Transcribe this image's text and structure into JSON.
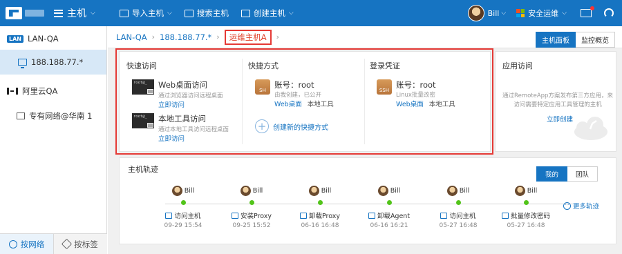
{
  "topbar": {
    "menu_label": "主机",
    "actions": [
      {
        "label": "导入主机",
        "has_caret": true
      },
      {
        "label": "搜索主机",
        "has_caret": false
      },
      {
        "label": "创建主机",
        "has_caret": true
      }
    ],
    "user_name": "Bill",
    "ops_label": "安全运维",
    "brand_color": "#1674c2"
  },
  "sidebar": {
    "lan_badge": "LAN",
    "lan_label": "LAN-QA",
    "host_label": "188.188.77.*",
    "aliyun_label": "阿里云QA",
    "vpc_label": "专有网络@华南 1",
    "tabs": [
      {
        "label": "按网络",
        "icon": "globe-icon",
        "active": true
      },
      {
        "label": "按标签",
        "icon": "tag-icon",
        "active": false
      }
    ]
  },
  "breadcrumb": {
    "items": [
      "LAN-QA",
      "188.188.77.*"
    ],
    "current": "运维主机A"
  },
  "view_tabs": [
    "主机面板",
    "监控概览"
  ],
  "quick_access": {
    "title": "快速访问",
    "items": [
      {
        "title": "Web桌面访问",
        "desc": "通过浏览器访问远程桌面",
        "link": "立即访问",
        "terminal_text": "root@_"
      },
      {
        "title": "本地工具访问",
        "desc": "通过本地工具访问远程桌面",
        "link": "立即访问",
        "terminal_text": "root@_"
      }
    ]
  },
  "shortcuts": {
    "title": "快捷方式",
    "account": "账号：root",
    "owner": "由我创建，已公开",
    "links": [
      "Web桌面",
      "本地工具"
    ],
    "icon_text": "SH",
    "create_label": "创建新的快捷方式"
  },
  "credentials": {
    "title": "登录凭证",
    "account": "账号：root",
    "desc": "Linux批量改密",
    "links": [
      "Web桌面",
      "本地工具"
    ],
    "icon_text": "SSH"
  },
  "app_access": {
    "title": "应用访问",
    "desc": "通过RemoteApp方案发布第三方应用，来访问需要特定应用工具管理的主机",
    "link": "立即创建"
  },
  "track": {
    "title": "主机轨迹",
    "filters": [
      "我的",
      "团队"
    ],
    "more_label": "更多轨迹",
    "events": [
      {
        "user": "Bill",
        "action": "访问主机",
        "time": "09-29 15:54",
        "icon": "monitor-icon"
      },
      {
        "user": "Bill",
        "action": "安装Proxy",
        "time": "09-25 15:52",
        "icon": "network-icon"
      },
      {
        "user": "Bill",
        "action": "卸载Proxy",
        "time": "06-16 16:48",
        "icon": "network-icon"
      },
      {
        "user": "Bill",
        "action": "卸载Agent",
        "time": "06-16 16:21",
        "icon": "home-icon"
      },
      {
        "user": "Bill",
        "action": "访问主机",
        "time": "05-27 16:48",
        "icon": "monitor-icon"
      },
      {
        "user": "Bill",
        "action": "批量修改密码",
        "time": "05-27 16:48",
        "icon": "monitor-key-icon"
      }
    ]
  }
}
